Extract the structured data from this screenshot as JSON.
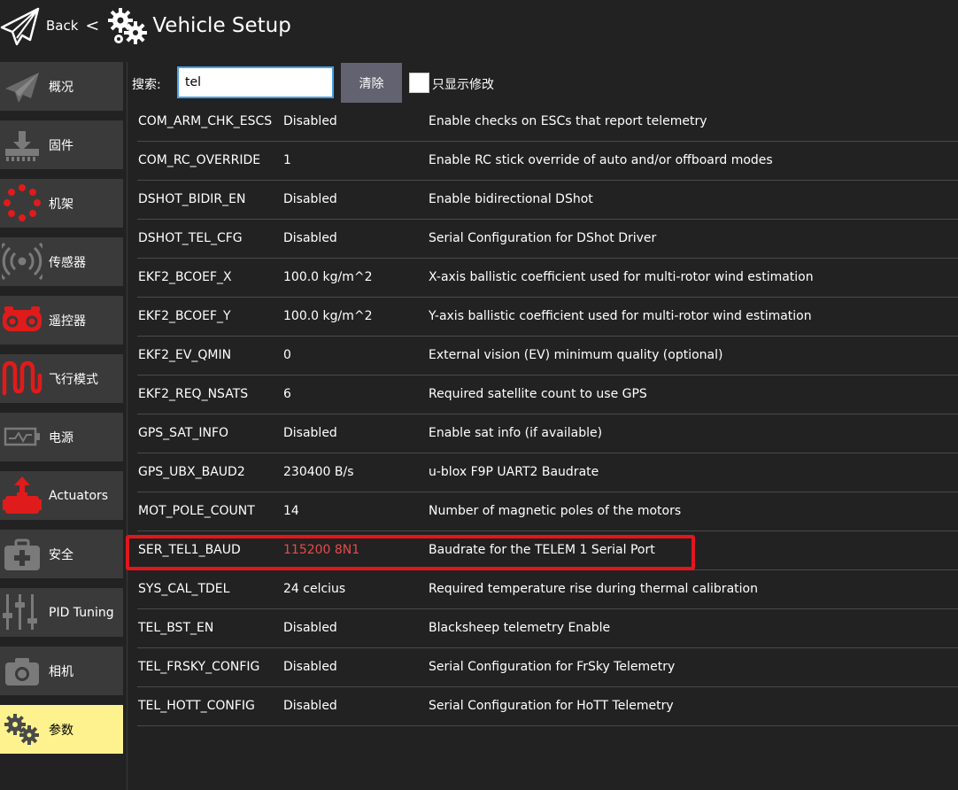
{
  "header": {
    "back_label": "Back",
    "chevron": "<",
    "title": "Vehicle Setup"
  },
  "sidebar": {
    "items": [
      {
        "label": "概况",
        "icon": "paper-plane-icon"
      },
      {
        "label": "固件",
        "icon": "download-firmware-icon"
      },
      {
        "label": "机架",
        "icon": "airframe-dots-icon"
      },
      {
        "label": "传感器",
        "icon": "sensor-waves-icon"
      },
      {
        "label": "遥控器",
        "icon": "radio-controller-icon"
      },
      {
        "label": "飞行模式",
        "icon": "flight-mode-wave-icon"
      },
      {
        "label": "电源",
        "icon": "battery-icon"
      },
      {
        "label": "Actuators",
        "icon": "actuator-icon"
      },
      {
        "label": "安全",
        "icon": "first-aid-kit-icon"
      },
      {
        "label": "PID Tuning",
        "icon": "sliders-icon"
      },
      {
        "label": "相机",
        "icon": "camera-icon"
      },
      {
        "label": "参数",
        "icon": "gears-icon",
        "active": true
      }
    ]
  },
  "search": {
    "label": "搜索:",
    "value": "tel",
    "clear_label": "清除",
    "modified_only_label": "只显示修改"
  },
  "params": [
    {
      "name": "COM_ARM_CHK_ESCS",
      "value": "Disabled",
      "description": "Enable checks on ESCs that report telemetry"
    },
    {
      "name": "COM_RC_OVERRIDE",
      "value": "1",
      "description": "Enable RC stick override of auto and/or offboard modes"
    },
    {
      "name": "DSHOT_BIDIR_EN",
      "value": "Disabled",
      "description": "Enable bidirectional DShot"
    },
    {
      "name": "DSHOT_TEL_CFG",
      "value": "Disabled",
      "description": "Serial Configuration for DShot Driver"
    },
    {
      "name": "EKF2_BCOEF_X",
      "value": "100.0 kg/m^2",
      "description": "X-axis ballistic coefficient used for multi-rotor wind estimation"
    },
    {
      "name": "EKF2_BCOEF_Y",
      "value": "100.0 kg/m^2",
      "description": "Y-axis ballistic coefficient used for multi-rotor wind estimation"
    },
    {
      "name": "EKF2_EV_QMIN",
      "value": "0",
      "description": "External vision (EV) minimum quality (optional)"
    },
    {
      "name": "EKF2_REQ_NSATS",
      "value": "6",
      "description": "Required satellite count to use GPS"
    },
    {
      "name": "GPS_SAT_INFO",
      "value": "Disabled",
      "description": "Enable sat info (if available)"
    },
    {
      "name": "GPS_UBX_BAUD2",
      "value": "230400 B/s",
      "description": "u-blox F9P UART2 Baudrate"
    },
    {
      "name": "MOT_POLE_COUNT",
      "value": "14",
      "description": "Number of magnetic poles of the motors"
    },
    {
      "name": "SER_TEL1_BAUD",
      "value": "115200 8N1",
      "description": "Baudrate for the TELEM 1 Serial Port",
      "modified": true
    },
    {
      "name": "SYS_CAL_TDEL",
      "value": "24 celcius",
      "description": "Required temperature rise during thermal calibration"
    },
    {
      "name": "TEL_BST_EN",
      "value": "Disabled",
      "description": "Blacksheep telemetry Enable"
    },
    {
      "name": "TEL_FRSKY_CONFIG",
      "value": "Disabled",
      "description": "Serial Configuration for FrSky Telemetry"
    },
    {
      "name": "TEL_HOTT_CONFIG",
      "value": "Disabled",
      "description": "Serial Configuration for HoTT Telemetry"
    }
  ],
  "colors": {
    "background": "#222222",
    "sidebar_item": "#3a3a3a",
    "sidebar_active": "#fdf28e",
    "modified_value": "#e84a4a",
    "highlight": "#e2161c",
    "icon_red": "#e01b1b"
  }
}
